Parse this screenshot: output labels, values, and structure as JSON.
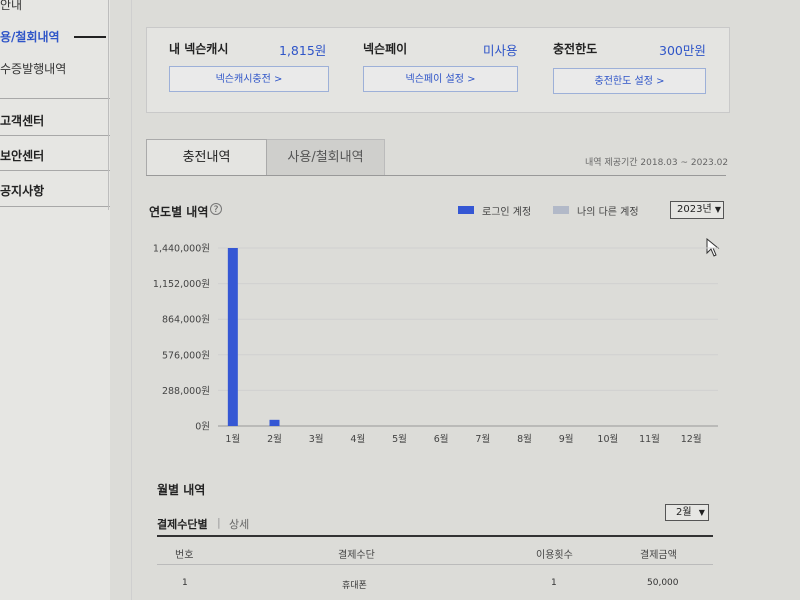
{
  "sidebar": {
    "items": [
      {
        "label": "안내",
        "active": false
      },
      {
        "label": "용/철회내역",
        "active": true
      },
      {
        "label": "수증발행내역",
        "active": false
      }
    ],
    "sections": [
      {
        "label": "고객센터"
      },
      {
        "label": "보안센터"
      },
      {
        "label": "공지사항"
      }
    ]
  },
  "summary": {
    "cash_label": "내 넥슨캐시",
    "cash_value": "1,815원",
    "cash_button": "넥슨캐시충전 >",
    "pay_label": "넥슨페이",
    "pay_value": "미사용",
    "pay_button": "넥슨페이 설정 >",
    "limit_label": "충전한도",
    "limit_value": "300만원",
    "limit_button": "충전한도 설정 >"
  },
  "tabs": [
    {
      "label": "충전내역",
      "active": true
    },
    {
      "label": "사용/철회내역",
      "active": false
    }
  ],
  "period_text": "내역 제공기간 2018.03 ~ 2023.02",
  "chart_section": {
    "title": "연도별 내역",
    "help_icon": "question-circle-icon",
    "legend": [
      {
        "label": "로그인 계정",
        "color": "#3557d4"
      },
      {
        "label": "나의 다른 계정",
        "color": "#b2b9c8"
      }
    ],
    "year_select": "2023년"
  },
  "chart_data": {
    "type": "bar",
    "categories": [
      "1월",
      "2월",
      "3월",
      "4월",
      "5월",
      "6월",
      "7월",
      "8월",
      "9월",
      "10월",
      "11월",
      "12월"
    ],
    "series": [
      {
        "name": "로그인 계정",
        "values": [
          1440000,
          50000,
          0,
          0,
          0,
          0,
          0,
          0,
          0,
          0,
          0,
          0
        ]
      }
    ],
    "ylim": [
      0,
      1440000
    ],
    "yticks": [
      "0원",
      "288,000원",
      "576,000원",
      "864,000원",
      "1,152,000원",
      "1,440,000원"
    ],
    "ytick_values": [
      0,
      288000,
      576000,
      864000,
      1152000,
      1440000
    ],
    "grid": true,
    "legend_position": "top-right",
    "bar_color": "#3557d4"
  },
  "monthly": {
    "title": "월별 내역",
    "sub_tab_active": "결제수단별",
    "sub_separator": "|",
    "sub_tab_other": "상세",
    "month_select": "2월",
    "columns": [
      "번호",
      "결제수단",
      "이용횟수",
      "결제금액"
    ],
    "rows": [
      [
        "1",
        "휴대폰",
        "1",
        "50,000"
      ]
    ]
  }
}
